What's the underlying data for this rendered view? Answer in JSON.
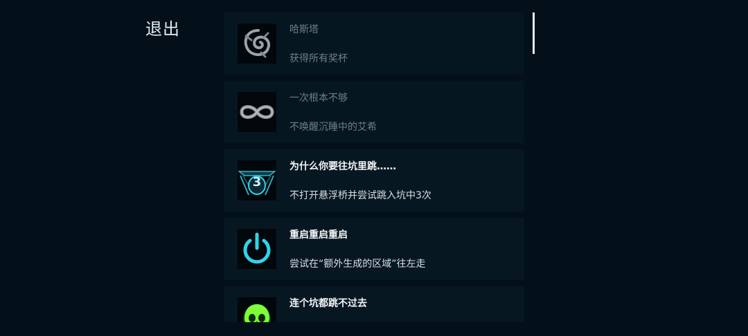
{
  "header": {
    "exit_label": "退出"
  },
  "achievements": [
    {
      "title": "哈斯塔",
      "description": "获得所有奖杯",
      "locked": true,
      "icon": "spiral-sigil-icon"
    },
    {
      "title": "一次根本不够",
      "description": "不唤醒沉睡中的艾希",
      "locked": true,
      "icon": "infinity-icon"
    },
    {
      "title": "为什么你要往坑里跳……",
      "description": "不打开悬浮桥并尝试跳入坑中3次",
      "locked": false,
      "icon": "pit-three-icon",
      "icon_number": "3"
    },
    {
      "title": "重启重启重启",
      "description": "尝试在“额外生成的区域”往左走",
      "locked": false,
      "icon": "power-icon"
    },
    {
      "title": "连个坑都跳不过去",
      "description": "",
      "locked": false,
      "icon": "green-skull-icon"
    }
  ],
  "colors": {
    "background": "#031019",
    "card": "#071721",
    "accent_cyan": "#2fd4e8",
    "skull_green": "#7cff3a"
  }
}
